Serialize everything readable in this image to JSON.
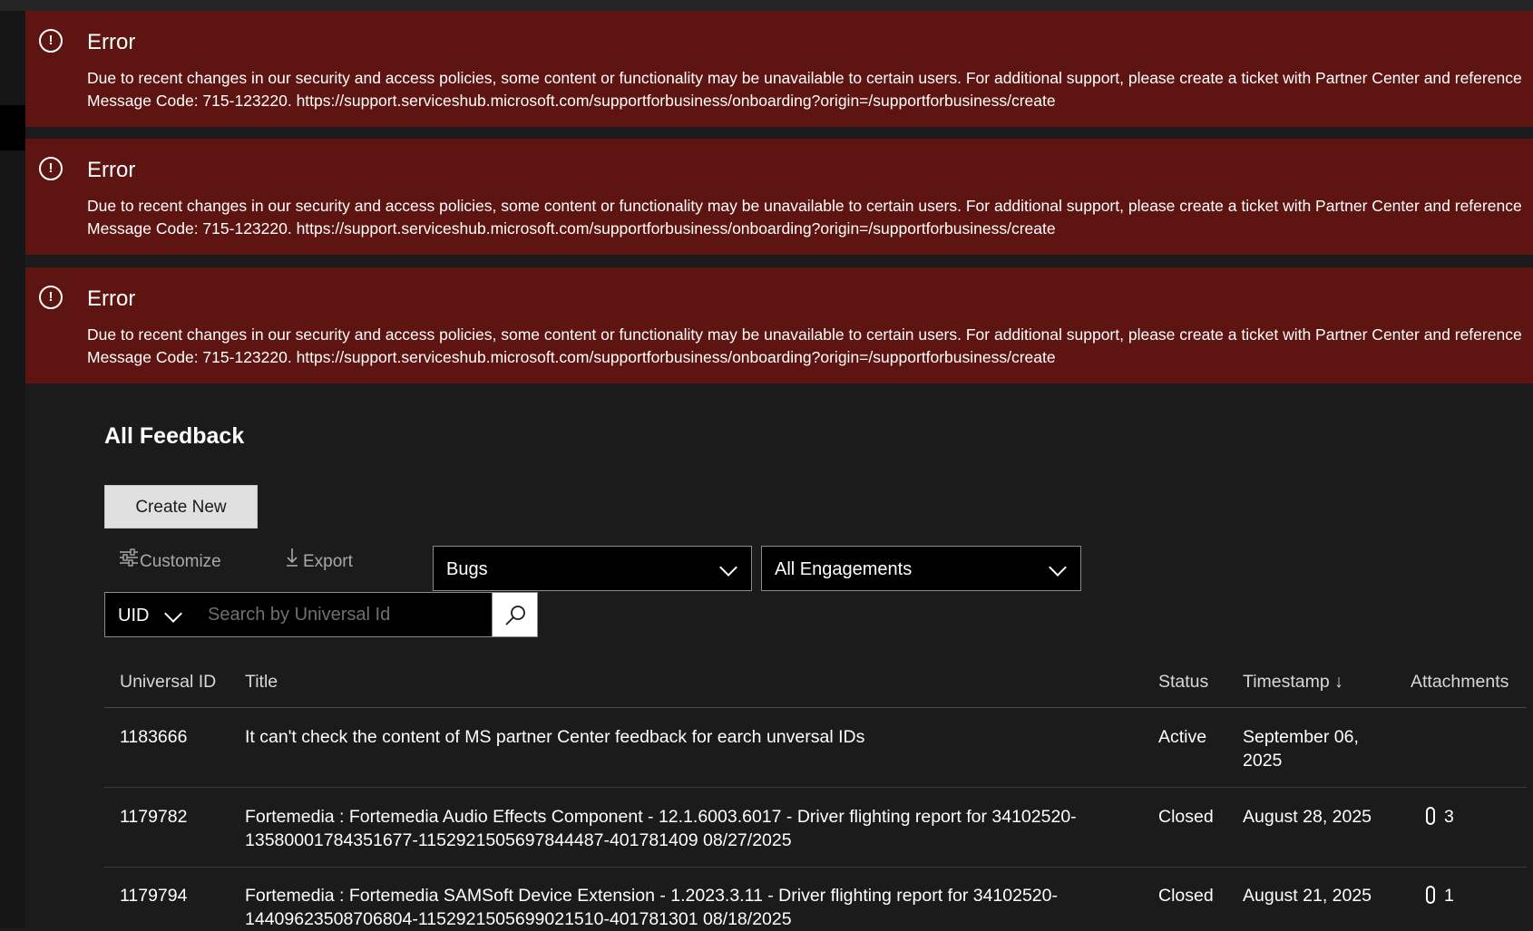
{
  "errors": [
    {
      "title": "Error",
      "message": "Due to recent changes in our security and access policies, some content or functionality may be unavailable to certain users. For additional support, please create a ticket with Partner Center and reference Message Code: 715-123220. https://support.serviceshub.microsoft.com/supportforbusiness/onboarding?origin=/supportforbusiness/create"
    },
    {
      "title": "Error",
      "message": "Due to recent changes in our security and access policies, some content or functionality may be unavailable to certain users. For additional support, please create a ticket with Partner Center and reference Message Code: 715-123220. https://support.serviceshub.microsoft.com/supportforbusiness/onboarding?origin=/supportforbusiness/create"
    },
    {
      "title": "Error",
      "message": "Due to recent changes in our security and access policies, some content or functionality may be unavailable to certain users. For additional support, please create a ticket with Partner Center and reference Message Code: 715-123220. https://support.serviceshub.microsoft.com/supportforbusiness/onboarding?origin=/supportforbusiness/create"
    }
  ],
  "page": {
    "title": "All Feedback",
    "create_label": "Create New",
    "customize_label": "Customize",
    "export_label": "Export"
  },
  "filters": {
    "type_selected": "Bugs",
    "engagement_selected": "All Engagements"
  },
  "search": {
    "field_selected": "UID",
    "placeholder": "Search by Universal Id",
    "value": ""
  },
  "table": {
    "columns": {
      "id": "Universal ID",
      "title": "Title",
      "status": "Status",
      "timestamp": "Timestamp",
      "attachments": "Attachments"
    },
    "sort_indicator": "↓",
    "rows": [
      {
        "id": "1183666",
        "title": "It can't check the content of MS partner Center feedback for earch unversal IDs",
        "status": "Active",
        "timestamp": "September 06, 2025",
        "attachments": ""
      },
      {
        "id": "1179782",
        "title": "Fortemedia : Fortemedia Audio Effects Component - 12.1.6003.6017 - Driver flighting report for 34102520-13580001784351677-1152921505697844487-401781409 08/27/2025",
        "status": "Closed",
        "timestamp": "August 28, 2025",
        "attachments": "3"
      },
      {
        "id": "1179794",
        "title": "Fortemedia : Fortemedia SAMSoft Device Extension - 1.2023.3.11 - Driver flighting report for 34102520-14409623508706804-1152921505699021510-401781301 08/18/2025",
        "status": "Closed",
        "timestamp": "August 21, 2025",
        "attachments": "1"
      }
    ]
  },
  "icons": {
    "error": "exclamation-circle-icon",
    "customize": "sliders-icon",
    "export": "download-arrow-icon",
    "search": "magnifier-icon",
    "attachment": "paperclip-icon",
    "dropdown": "chevron-down-icon"
  },
  "colors": {
    "error_background": "#5e1411",
    "page_background": "#1b1b1b",
    "control_background": "#000000"
  }
}
